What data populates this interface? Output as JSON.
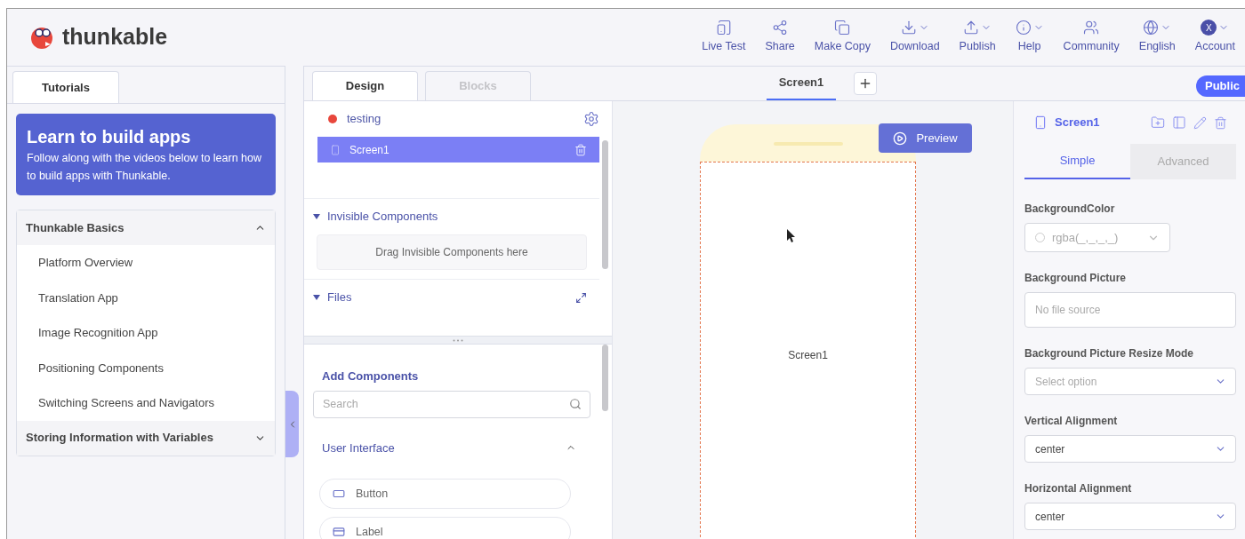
{
  "app": {
    "name": "thunkable"
  },
  "toolbar": [
    {
      "label": "Live Test",
      "kind": "live-test",
      "dropdown": false
    },
    {
      "label": "Share",
      "kind": "share",
      "dropdown": false
    },
    {
      "label": "Make Copy",
      "kind": "copy",
      "dropdown": false
    },
    {
      "label": "Download",
      "kind": "download",
      "dropdown": true
    },
    {
      "label": "Publish",
      "kind": "publish",
      "dropdown": true
    },
    {
      "label": "Help",
      "kind": "help",
      "dropdown": true
    },
    {
      "label": "Community",
      "kind": "community",
      "dropdown": false
    },
    {
      "label": "English",
      "kind": "language",
      "dropdown": true
    },
    {
      "label": "Account",
      "kind": "account",
      "initial": "X",
      "dropdown": true
    }
  ],
  "left_panel": {
    "tabs": [
      {
        "label": "Tutorials",
        "selected": true
      }
    ],
    "banner": {
      "title": "Learn to build apps",
      "text": "Follow along with the videos below to learn how to build apps with Thunkable."
    },
    "sections": [
      {
        "title": "Thunkable Basics",
        "expanded": true,
        "items": [
          "Platform Overview",
          "Translation App",
          "Image Recognition App",
          "Positioning Components",
          "Switching Screens and Navigators"
        ]
      },
      {
        "title": "Storing Information with Variables",
        "expanded": false
      }
    ]
  },
  "editor": {
    "tabs": [
      {
        "label": "Design",
        "selected": true
      },
      {
        "label": "Blocks",
        "selected": false
      }
    ],
    "screen_tabs": [
      {
        "label": "Screen1",
        "selected": true
      }
    ],
    "visibility": "Public"
  },
  "components": {
    "project": "testing",
    "screens": [
      {
        "label": "Screen1",
        "selected": true
      }
    ],
    "sections": [
      {
        "title": "Invisible Components",
        "expanded": true,
        "hint": "Drag Invisible Components here"
      },
      {
        "title": "Files",
        "expanded": true
      }
    ],
    "add": {
      "title": "Add Components",
      "search_placeholder": "Search",
      "category": {
        "title": "User Interface",
        "expanded": true
      },
      "items": [
        {
          "label": "Button",
          "kind": "button"
        },
        {
          "label": "Label",
          "kind": "label"
        }
      ]
    }
  },
  "canvas": {
    "preview": "Preview",
    "screen_label": "Screen1"
  },
  "properties": {
    "title": "Screen1",
    "tabs": [
      {
        "label": "Simple",
        "selected": true
      },
      {
        "label": "Advanced",
        "selected": false
      }
    ],
    "fields": [
      {
        "label": "BackgroundColor",
        "kind": "color",
        "placeholder": "rgba(_,_,_,_)"
      },
      {
        "label": "Background Picture",
        "kind": "file",
        "placeholder": "No file source"
      },
      {
        "label": "Background Picture Resize Mode",
        "kind": "select",
        "placeholder": "Select option"
      },
      {
        "label": "Vertical Alignment",
        "kind": "select",
        "value": "center"
      },
      {
        "label": "Horizontal Alignment",
        "kind": "select",
        "value": "center"
      }
    ]
  }
}
